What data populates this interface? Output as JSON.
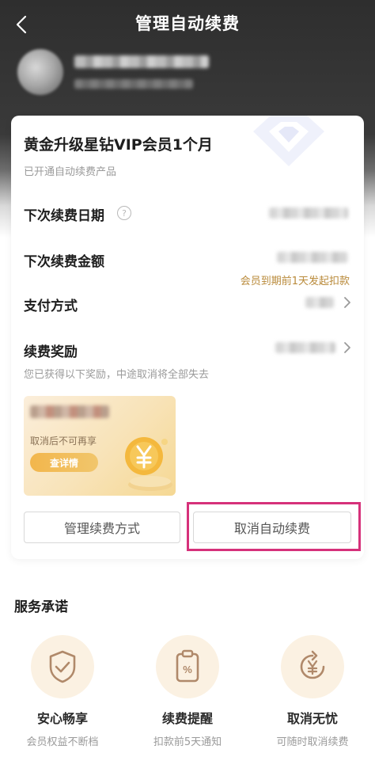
{
  "header": {
    "title": "管理自动续费"
  },
  "subscription": {
    "product_name": "黄金升级星钻VIP会员1个月",
    "status": "已开通自动续费产品",
    "next_date_label": "下次续费日期",
    "next_amount_label": "下次续费金额",
    "deduction_note": "会员到期前1天发起扣款",
    "payment_label": "支付方式",
    "reward_label": "续费奖励",
    "reward_note": "您已获得以下奖励，中途取消将全部失去"
  },
  "coupon": {
    "note": "取消后不可再享",
    "button": "查详情",
    "coin_symbol": "¥"
  },
  "actions": {
    "manage_payment": "管理续费方式",
    "cancel_renewal": "取消自动续费"
  },
  "services": {
    "title": "服务承诺",
    "items": [
      {
        "title": "安心畅享",
        "subtitle": "会员权益不断档",
        "icon": "shield-check-icon"
      },
      {
        "title": "续费提醒",
        "subtitle": "扣款前5天通知",
        "icon": "reminder-note-icon"
      },
      {
        "title": "取消无忧",
        "subtitle": "可随时取消续费",
        "icon": "refund-cycle-icon"
      }
    ]
  },
  "colors": {
    "accent_gold": "#b98a3a",
    "highlight": "#d6317a",
    "icon_brown": "#b0896a"
  }
}
